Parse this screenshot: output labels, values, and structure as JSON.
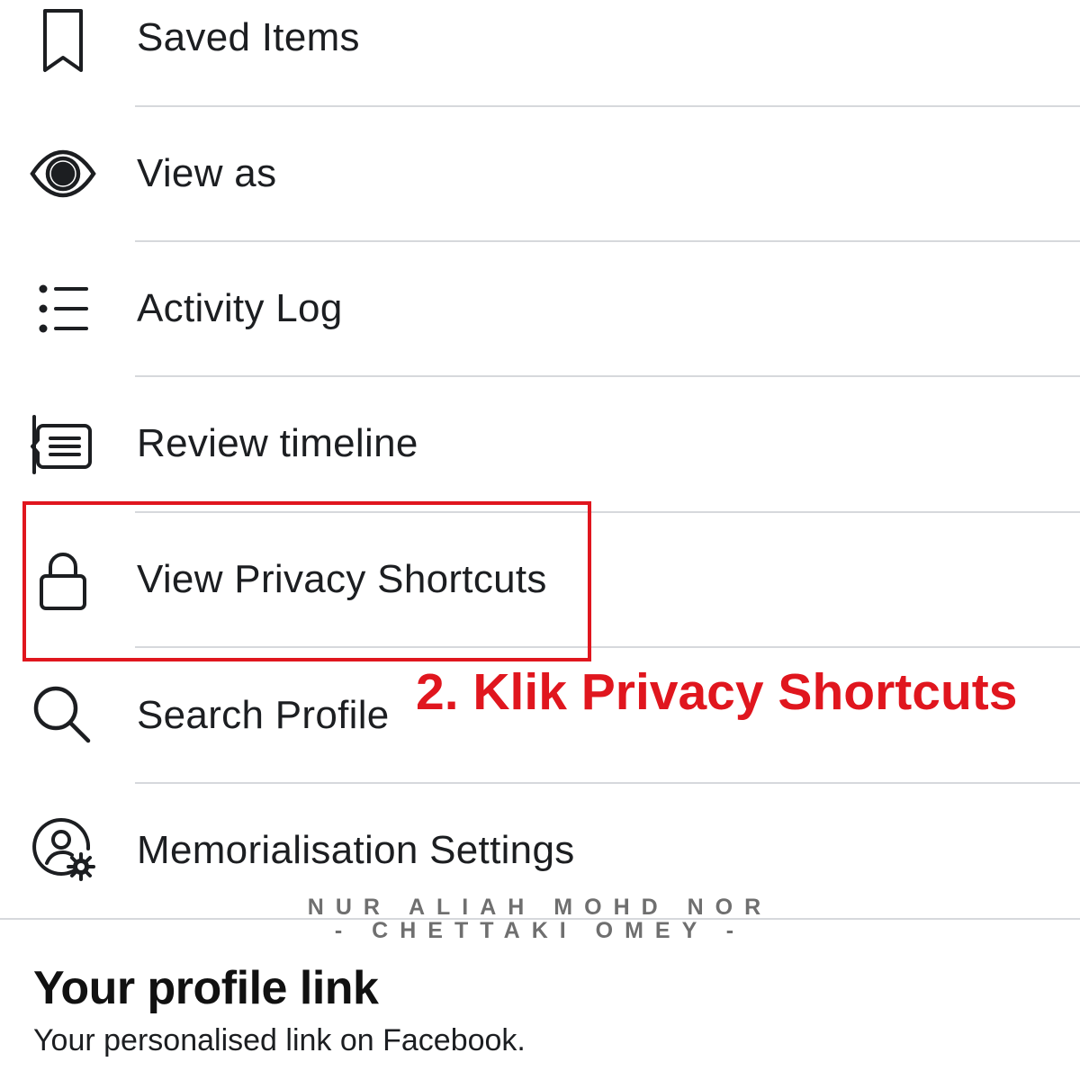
{
  "menu": {
    "items": [
      {
        "label": "Saved Items",
        "icon": "bookmark-icon"
      },
      {
        "label": "View as",
        "icon": "eye-icon"
      },
      {
        "label": "Activity Log",
        "icon": "list-icon"
      },
      {
        "label": "Review timeline",
        "icon": "timeline-review-icon"
      },
      {
        "label": "View Privacy Shortcuts",
        "icon": "lock-icon"
      },
      {
        "label": "Search Profile",
        "icon": "search-icon"
      },
      {
        "label": "Memorialisation Settings",
        "icon": "user-settings-icon"
      }
    ]
  },
  "annotation": {
    "text": "2. Klik Privacy Shortcuts",
    "color": "#e0161e"
  },
  "watermark": {
    "line1": "NUR ALIAH MOHD NOR",
    "line2": "- CHETTAKI OMEY -"
  },
  "profile_link": {
    "title": "Your profile link",
    "subtitle": "Your personalised link on Facebook."
  }
}
